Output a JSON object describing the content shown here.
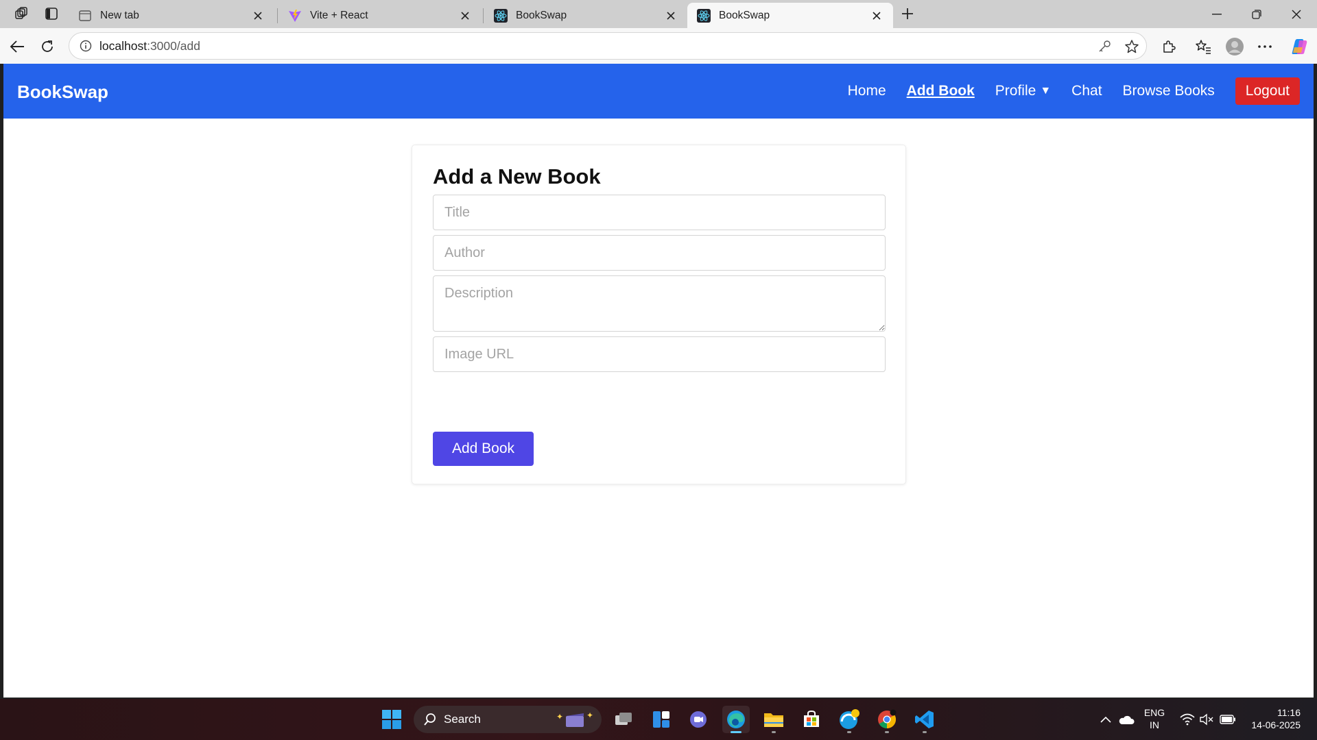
{
  "browser": {
    "tabs": [
      {
        "title": "New tab",
        "favicon": "newtab-icon"
      },
      {
        "title": "Vite + React",
        "favicon": "vite-icon"
      },
      {
        "title": "BookSwap",
        "favicon": "react-icon"
      },
      {
        "title": "BookSwap",
        "favicon": "react-icon",
        "active": true
      }
    ],
    "address": {
      "host": "localhost",
      "path": ":3000/add"
    }
  },
  "app": {
    "brand": "BookSwap",
    "nav": {
      "home": "Home",
      "add_book": "Add Book",
      "profile": "Profile",
      "profile_caret": "▼",
      "chat": "Chat",
      "browse": "Browse Books",
      "logout": "Logout"
    },
    "colors": {
      "nav_bg": "#2563eb",
      "logout_bg": "#dc2626",
      "submit_bg": "#4f46e5"
    }
  },
  "form": {
    "heading": "Add a New Book",
    "title_placeholder": "Title",
    "author_placeholder": "Author",
    "description_placeholder": "Description",
    "image_placeholder": "Image URL",
    "submit_label": "Add Book"
  },
  "taskbar": {
    "search_label": "Search",
    "lang_line1": "ENG",
    "lang_line2": "IN",
    "time": "11:16",
    "date": "14-06-2025"
  }
}
